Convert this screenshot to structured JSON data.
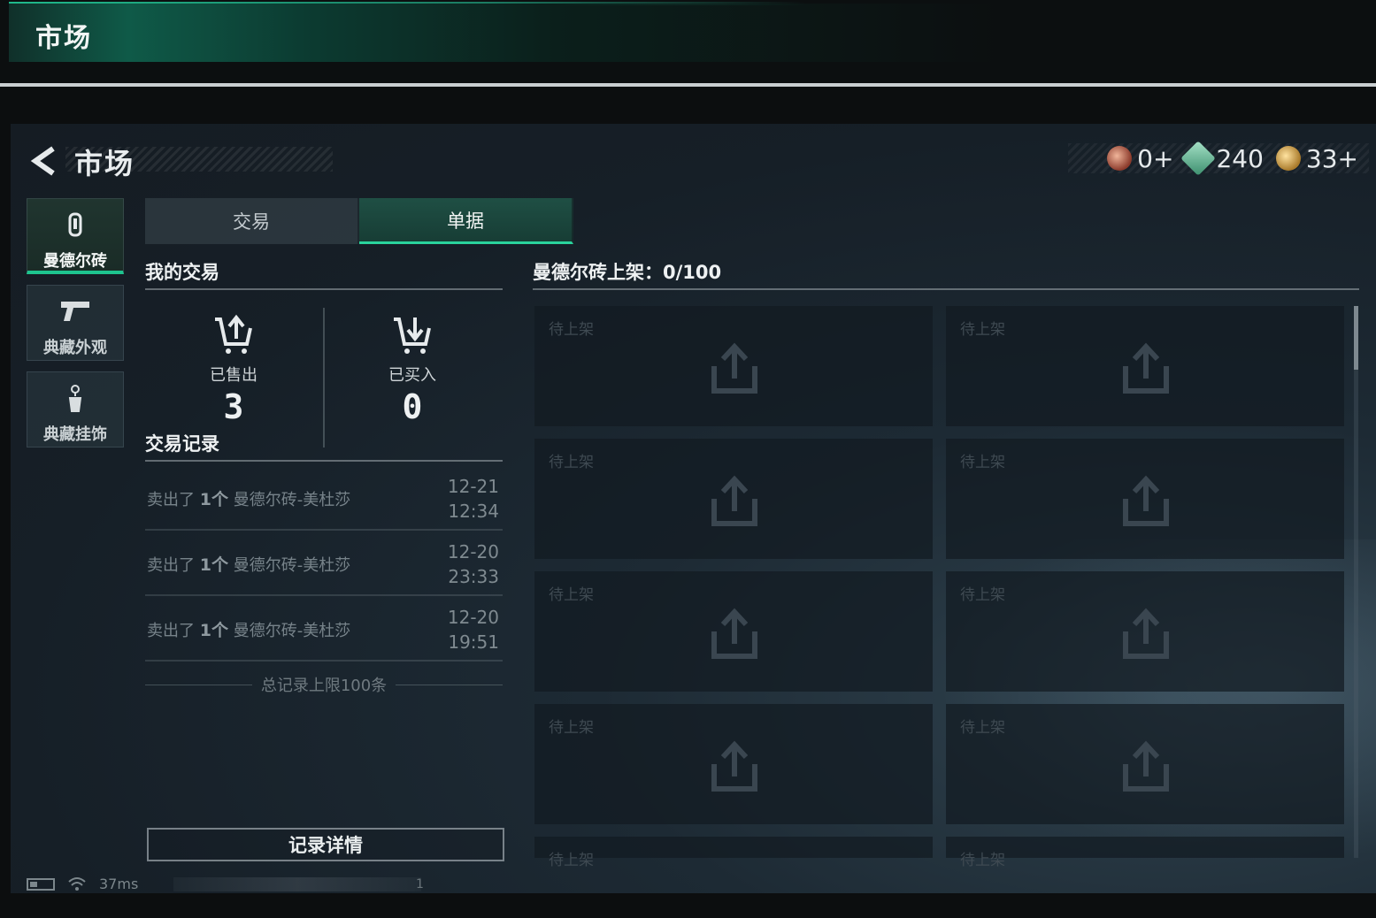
{
  "outer_header": {
    "title": "市场"
  },
  "header": {
    "title": "市场"
  },
  "currencies": [
    {
      "icon": "red-gem-currency-icon",
      "value": "0+"
    },
    {
      "icon": "green-ticket-currency-icon",
      "value": "240"
    },
    {
      "icon": "gold-coin-currency-icon",
      "value": "33+"
    }
  ],
  "nav": [
    {
      "icon": "brick-icon",
      "label": "曼德尔砖",
      "active": true
    },
    {
      "icon": "pistol-icon",
      "label": "典藏外观",
      "active": false
    },
    {
      "icon": "charm-icon",
      "label": "典藏挂饰",
      "active": false
    }
  ],
  "tabs": [
    {
      "label": "交易",
      "active": false
    },
    {
      "label": "单据",
      "active": true
    }
  ],
  "my_trades": {
    "title": "我的交易",
    "sold": {
      "label": "已售出",
      "value": "3"
    },
    "bought": {
      "label": "已买入",
      "value": "0"
    }
  },
  "records": {
    "title": "交易记录",
    "items": [
      {
        "action": "卖出了",
        "qty": "1个",
        "item": "曼德尔砖-美杜莎",
        "date": "12-21",
        "time": "12:34"
      },
      {
        "action": "卖出了",
        "qty": "1个",
        "item": "曼德尔砖-美杜莎",
        "date": "12-20",
        "time": "23:33"
      },
      {
        "action": "卖出了",
        "qty": "1个",
        "item": "曼德尔砖-美杜莎",
        "date": "12-20",
        "time": "19:51"
      }
    ],
    "limit_note": "总记录上限100条",
    "detail_button": "记录详情"
  },
  "listings": {
    "title": "曼德尔砖上架：0/100",
    "slot_label": "待上架",
    "slots": 10
  },
  "status": {
    "ping": "37ms",
    "extra": "1"
  },
  "colors": {
    "accent": "#1ec48e",
    "panel": "#161f27"
  }
}
